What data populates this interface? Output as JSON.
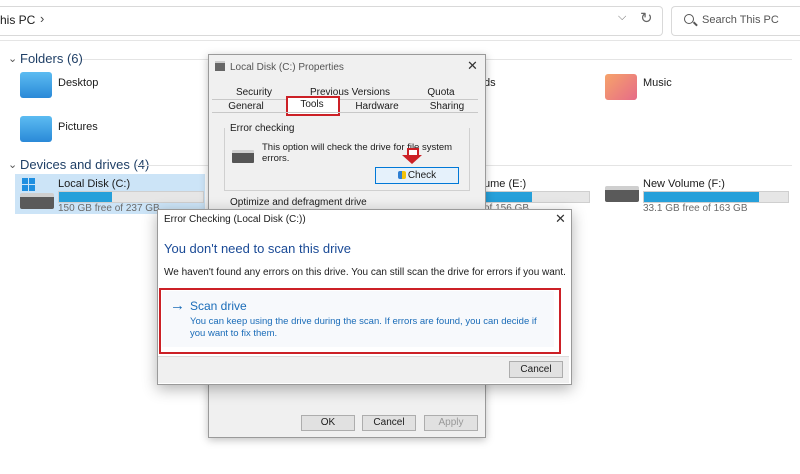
{
  "explorer": {
    "address": "his PC",
    "search_placeholder": "Search This PC",
    "folders_header": "Folders (6)",
    "folders": [
      {
        "label": "Desktop"
      },
      {
        "label": "Pictures"
      },
      {
        "label": "ds"
      },
      {
        "label": "Music"
      }
    ],
    "drives_header": "Devices and drives (4)",
    "drives": [
      {
        "name": "Local Disk (C:)",
        "free": "150 GB free of 237 GB",
        "used_fraction": 0.37
      },
      {
        "name": "ume (E:)",
        "free": "of 156 GB",
        "used_fraction": 0.45
      },
      {
        "name": "New Volume (F:)",
        "free": "33.1 GB free of 163 GB",
        "used_fraction": 0.8
      }
    ]
  },
  "properties": {
    "title": "Local Disk (C:) Properties",
    "tabs_row1": [
      "Security",
      "Previous Versions",
      "Quota"
    ],
    "tabs_row2": [
      "General",
      "Tools",
      "Hardware",
      "Sharing"
    ],
    "error_checking_title": "Error checking",
    "error_checking_text": "This option will check the drive for file system errors.",
    "check_button": "Check",
    "optimize_title": "Optimize and defragment drive",
    "ok": "OK",
    "cancel": "Cancel",
    "apply": "Apply"
  },
  "error_dialog": {
    "title": "Error Checking (Local Disk (C:))",
    "heading": "You don't need to scan this drive",
    "body": "We haven't found any errors on this drive. You can still scan the drive for errors if you want.",
    "scan_title": "Scan drive",
    "scan_desc": "You can keep using the drive during the scan. If errors are found, you can decide if you want to fix them.",
    "cancel": "Cancel"
  },
  "colors": {
    "accent": "#1a6cb8",
    "highlight": "#cc2026",
    "drive_bar": "#26a0da"
  }
}
